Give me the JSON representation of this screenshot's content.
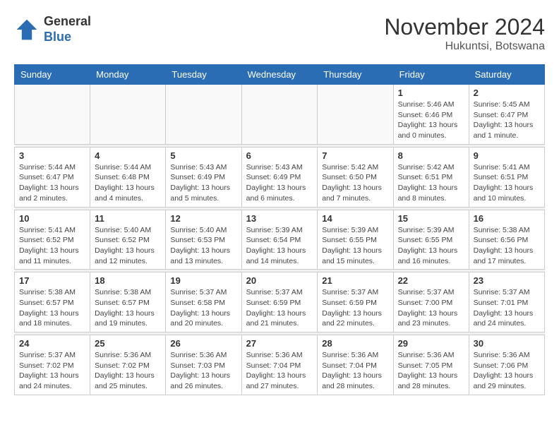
{
  "logo": {
    "general": "General",
    "blue": "Blue"
  },
  "header": {
    "month": "November 2024",
    "location": "Hukuntsi, Botswana"
  },
  "weekdays": [
    "Sunday",
    "Monday",
    "Tuesday",
    "Wednesday",
    "Thursday",
    "Friday",
    "Saturday"
  ],
  "weeks": [
    [
      {
        "day": "",
        "info": ""
      },
      {
        "day": "",
        "info": ""
      },
      {
        "day": "",
        "info": ""
      },
      {
        "day": "",
        "info": ""
      },
      {
        "day": "",
        "info": ""
      },
      {
        "day": "1",
        "info": "Sunrise: 5:46 AM\nSunset: 6:46 PM\nDaylight: 13 hours and 0 minutes."
      },
      {
        "day": "2",
        "info": "Sunrise: 5:45 AM\nSunset: 6:47 PM\nDaylight: 13 hours and 1 minute."
      }
    ],
    [
      {
        "day": "3",
        "info": "Sunrise: 5:44 AM\nSunset: 6:47 PM\nDaylight: 13 hours and 2 minutes."
      },
      {
        "day": "4",
        "info": "Sunrise: 5:44 AM\nSunset: 6:48 PM\nDaylight: 13 hours and 4 minutes."
      },
      {
        "day": "5",
        "info": "Sunrise: 5:43 AM\nSunset: 6:49 PM\nDaylight: 13 hours and 5 minutes."
      },
      {
        "day": "6",
        "info": "Sunrise: 5:43 AM\nSunset: 6:49 PM\nDaylight: 13 hours and 6 minutes."
      },
      {
        "day": "7",
        "info": "Sunrise: 5:42 AM\nSunset: 6:50 PM\nDaylight: 13 hours and 7 minutes."
      },
      {
        "day": "8",
        "info": "Sunrise: 5:42 AM\nSunset: 6:51 PM\nDaylight: 13 hours and 8 minutes."
      },
      {
        "day": "9",
        "info": "Sunrise: 5:41 AM\nSunset: 6:51 PM\nDaylight: 13 hours and 10 minutes."
      }
    ],
    [
      {
        "day": "10",
        "info": "Sunrise: 5:41 AM\nSunset: 6:52 PM\nDaylight: 13 hours and 11 minutes."
      },
      {
        "day": "11",
        "info": "Sunrise: 5:40 AM\nSunset: 6:52 PM\nDaylight: 13 hours and 12 minutes."
      },
      {
        "day": "12",
        "info": "Sunrise: 5:40 AM\nSunset: 6:53 PM\nDaylight: 13 hours and 13 minutes."
      },
      {
        "day": "13",
        "info": "Sunrise: 5:39 AM\nSunset: 6:54 PM\nDaylight: 13 hours and 14 minutes."
      },
      {
        "day": "14",
        "info": "Sunrise: 5:39 AM\nSunset: 6:55 PM\nDaylight: 13 hours and 15 minutes."
      },
      {
        "day": "15",
        "info": "Sunrise: 5:39 AM\nSunset: 6:55 PM\nDaylight: 13 hours and 16 minutes."
      },
      {
        "day": "16",
        "info": "Sunrise: 5:38 AM\nSunset: 6:56 PM\nDaylight: 13 hours and 17 minutes."
      }
    ],
    [
      {
        "day": "17",
        "info": "Sunrise: 5:38 AM\nSunset: 6:57 PM\nDaylight: 13 hours and 18 minutes."
      },
      {
        "day": "18",
        "info": "Sunrise: 5:38 AM\nSunset: 6:57 PM\nDaylight: 13 hours and 19 minutes."
      },
      {
        "day": "19",
        "info": "Sunrise: 5:37 AM\nSunset: 6:58 PM\nDaylight: 13 hours and 20 minutes."
      },
      {
        "day": "20",
        "info": "Sunrise: 5:37 AM\nSunset: 6:59 PM\nDaylight: 13 hours and 21 minutes."
      },
      {
        "day": "21",
        "info": "Sunrise: 5:37 AM\nSunset: 6:59 PM\nDaylight: 13 hours and 22 minutes."
      },
      {
        "day": "22",
        "info": "Sunrise: 5:37 AM\nSunset: 7:00 PM\nDaylight: 13 hours and 23 minutes."
      },
      {
        "day": "23",
        "info": "Sunrise: 5:37 AM\nSunset: 7:01 PM\nDaylight: 13 hours and 24 minutes."
      }
    ],
    [
      {
        "day": "24",
        "info": "Sunrise: 5:37 AM\nSunset: 7:02 PM\nDaylight: 13 hours and 24 minutes."
      },
      {
        "day": "25",
        "info": "Sunrise: 5:36 AM\nSunset: 7:02 PM\nDaylight: 13 hours and 25 minutes."
      },
      {
        "day": "26",
        "info": "Sunrise: 5:36 AM\nSunset: 7:03 PM\nDaylight: 13 hours and 26 minutes."
      },
      {
        "day": "27",
        "info": "Sunrise: 5:36 AM\nSunset: 7:04 PM\nDaylight: 13 hours and 27 minutes."
      },
      {
        "day": "28",
        "info": "Sunrise: 5:36 AM\nSunset: 7:04 PM\nDaylight: 13 hours and 28 minutes."
      },
      {
        "day": "29",
        "info": "Sunrise: 5:36 AM\nSunset: 7:05 PM\nDaylight: 13 hours and 28 minutes."
      },
      {
        "day": "30",
        "info": "Sunrise: 5:36 AM\nSunset: 7:06 PM\nDaylight: 13 hours and 29 minutes."
      }
    ]
  ]
}
